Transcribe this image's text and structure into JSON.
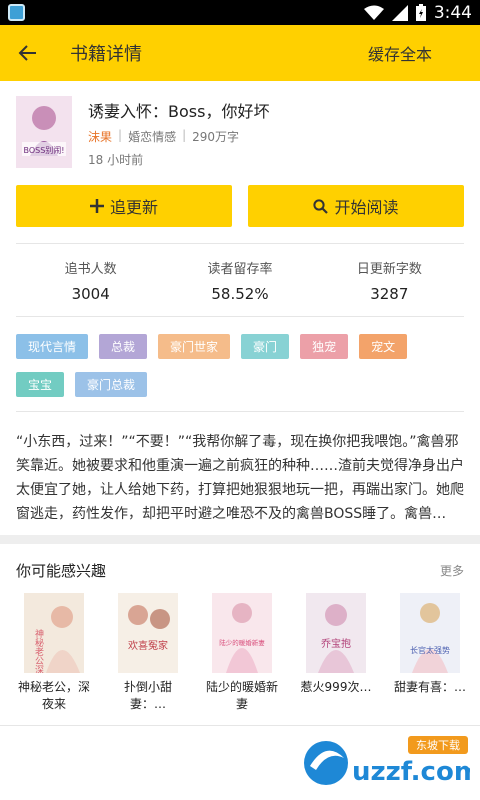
{
  "status_bar": {
    "time": "3:44"
  },
  "header": {
    "title": "书籍详情",
    "action": "缓存全本"
  },
  "book": {
    "title": "诱妻入怀：Boss，你好坏",
    "author": "沫果",
    "category": "婚恋情感",
    "word_count": "290万字",
    "updated": "18 小时前",
    "cover_text": "BOSS别闹!"
  },
  "buttons": {
    "follow": "追更新",
    "read": "开始阅读"
  },
  "stats": [
    {
      "label": "追书人数",
      "value": "3004"
    },
    {
      "label": "读者留存率",
      "value": "58.52%"
    },
    {
      "label": "日更新字数",
      "value": "3287"
    }
  ],
  "tags": [
    {
      "label": "现代言情",
      "color": "#8cc0e8"
    },
    {
      "label": "总裁",
      "color": "#b3a6d6"
    },
    {
      "label": "豪门世家",
      "color": "#f5bc8a"
    },
    {
      "label": "豪门",
      "color": "#88d2d4"
    },
    {
      "label": "独宠",
      "color": "#eca0a8"
    },
    {
      "label": "宠文",
      "color": "#f3a36a"
    },
    {
      "label": "宝宝",
      "color": "#72ccc2"
    },
    {
      "label": "豪门总裁",
      "color": "#9cc2e8"
    }
  ],
  "intro": "“小东西，过来！”“不要！”“我帮你解了毒，现在换你把我喂饱。”禽兽邪笑靠近。她被要求和他重演一遍之前疯狂的种种……渣前夫觉得净身出户太便宜了她，让人给她下药，打算把她狠狠地玩一把，再踹出家门。她爬窗逃走，药性发作，却把平时避之唯恐不及的禽兽BOSS睡了。禽兽…",
  "recommend": {
    "title": "你可能感兴趣",
    "more": "更多",
    "items": [
      {
        "name": "神秘老公，深夜来",
        "cover_text": "神秘老公深夜来",
        "bg": "#f3e9dd",
        "accent": "#d8606e"
      },
      {
        "name": "扑倒小甜妻：…",
        "cover_text": "欢喜冤家",
        "bg": "#f6efe6",
        "accent": "#c0414b"
      },
      {
        "name": "陆少的暖婚新妻",
        "cover_text": "陆少的暖婚新妻",
        "bg": "#f9e7ec",
        "accent": "#d94f7c"
      },
      {
        "name": "惹火999次…",
        "cover_text": "乔宝抱",
        "bg": "#f1e8ef",
        "accent": "#b2437a"
      },
      {
        "name": "甜妻有喜：…",
        "cover_text": "长官太强势",
        "bg": "#eef0f7",
        "accent": "#4b5fb0"
      }
    ]
  },
  "watermark": {
    "text": "uzzf.com",
    "badge": "东坡下载"
  }
}
